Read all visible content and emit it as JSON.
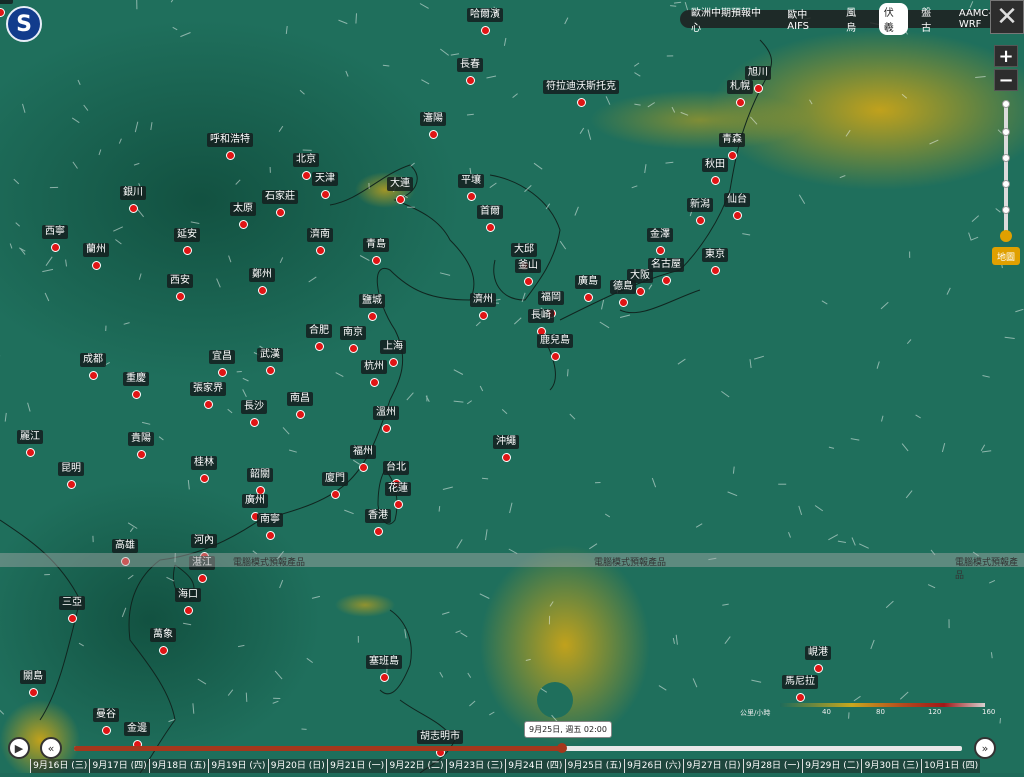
{
  "brand": {
    "logo_text": "S"
  },
  "topbar": {
    "items": [
      "歐洲中期預報中心",
      "歐中AIFS",
      "風烏",
      "伏羲",
      "盤古",
      "AAMC-WRF"
    ],
    "active": "伏羲"
  },
  "controls": {
    "zoom_in": "+",
    "zoom_out": "−",
    "close": "✕",
    "terrain_label": "地圖"
  },
  "notice": {
    "band_text": "電腦模式預報產品"
  },
  "legend": {
    "unit": "公里/小時",
    "ticks": [
      "40",
      "80",
      "120",
      "160"
    ]
  },
  "timeline": {
    "play": "▶",
    "back": "«",
    "forward": "»",
    "current": "9月25日, 週五 02:00",
    "progress": 0.55,
    "days": [
      "9月16日 (三)",
      "9月17日 (四)",
      "9月18日 (五)",
      "9月19日 (六)",
      "9月20日 (日)",
      "9月21日 (一)",
      "9月22日 (二)",
      "9月23日 (三)",
      "9月24日 (四)",
      "9月25日 (五)",
      "9月26日 (六)",
      "9月27日 (日)",
      "9月28日 (一)",
      "9月29日 (二)",
      "9月30日 (三)",
      "10月1日 (四)"
    ]
  },
  "cities": [
    "哈爾濱",
    "長春",
    "旭川",
    "札幌",
    "符拉迪沃斯托克",
    "瀋陽",
    "呼和浩特",
    "北京",
    "天津",
    "大連",
    "平壤",
    "青森",
    "秋田",
    "銀川",
    "石家莊",
    "太原",
    "首爾",
    "新潟",
    "仙台",
    "西寧",
    "延安",
    "濟南",
    "蘭州",
    "青島",
    "大邱",
    "金澤",
    "釜山",
    "名古屋",
    "東京",
    "西安",
    "鄭州",
    "廣島",
    "大阪",
    "德島",
    "濟州",
    "福岡",
    "鹽城",
    "合肥",
    "南京",
    "長崎",
    "鹿兒島",
    "上海",
    "成都",
    "宜昌",
    "武漢",
    "杭州",
    "重慶",
    "張家界",
    "長沙",
    "南昌",
    "溫州",
    "沖繩",
    "麗江",
    "貴陽",
    "福州",
    "昆明",
    "桂林",
    "台北",
    "韶關",
    "廈門",
    "花蓮",
    "廣州",
    "南寧",
    "香港",
    "高雄",
    "河內",
    "湛江",
    "海口",
    "三亞",
    "萬象",
    "峴港",
    "塞班島",
    "馬尼拉",
    "關島",
    "曼谷",
    "金邊",
    "胡志明市",
    "宿霧"
  ]
}
